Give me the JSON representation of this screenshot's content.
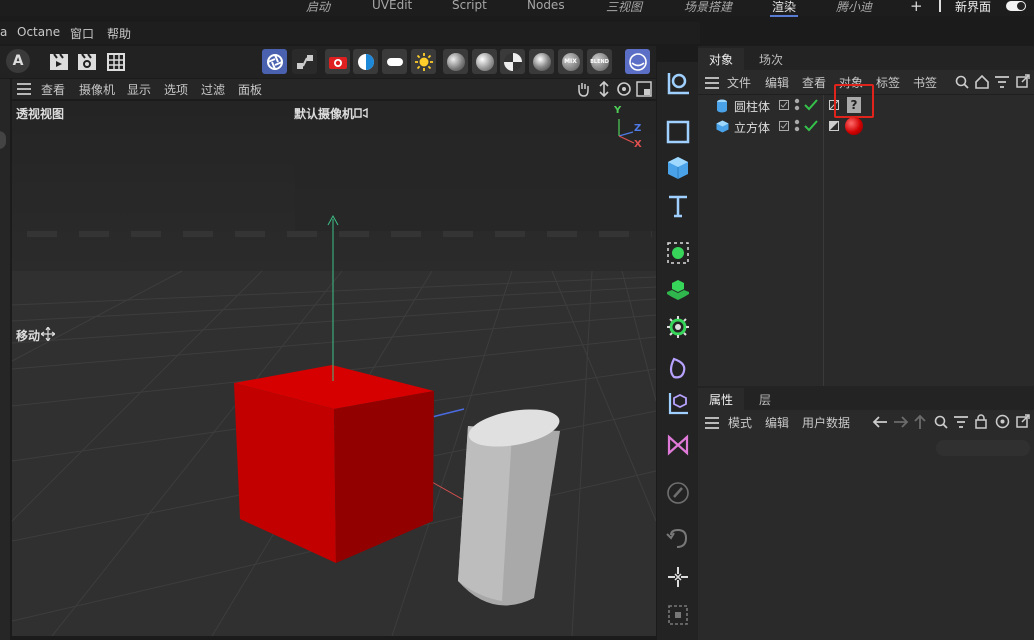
{
  "layout_tabs": [
    {
      "label": "启动",
      "italic": true
    },
    {
      "label": "UVEdit",
      "italic": false
    },
    {
      "label": "Script",
      "italic": false
    },
    {
      "label": "Nodes",
      "italic": false
    },
    {
      "label": "三视图",
      "italic": true
    },
    {
      "label": "场景搭建",
      "italic": true
    },
    {
      "label": "渲染",
      "italic": false,
      "active": true
    },
    {
      "label": "腾小迪",
      "italic": true
    }
  ],
  "new_layout_label": "新界面",
  "plus_label": "+",
  "menu": {
    "partial": "a",
    "items": [
      "Octane",
      "窗口",
      "帮助"
    ]
  },
  "viewport": {
    "menu": [
      "查看",
      "摄像机",
      "显示",
      "选项",
      "过滤",
      "面板"
    ],
    "name": "透视视图",
    "camera": "默认摄像机",
    "move_label": "移动",
    "axis": {
      "y": "Y",
      "z": "Z",
      "x": "X"
    }
  },
  "object_manager": {
    "tabs": [
      "对象",
      "场次"
    ],
    "menu": [
      "文件",
      "编辑",
      "查看",
      "对象",
      "标签",
      "书签"
    ],
    "objects": [
      {
        "name": "圆柱体",
        "tag": "?"
      },
      {
        "name": "立方体",
        "tag": "red-material"
      }
    ]
  },
  "attributes": {
    "tabs": [
      "属性",
      "层"
    ],
    "menu": [
      "模式",
      "编辑",
      "用户数据"
    ]
  },
  "toolbar_labels": {
    "mix": "MIX",
    "blend": "BLEND",
    "a": "A"
  },
  "colors": {
    "accent": "#5a7bd4",
    "cube": "#c40000",
    "highlight": "#e0241b",
    "check": "#35c24a"
  }
}
